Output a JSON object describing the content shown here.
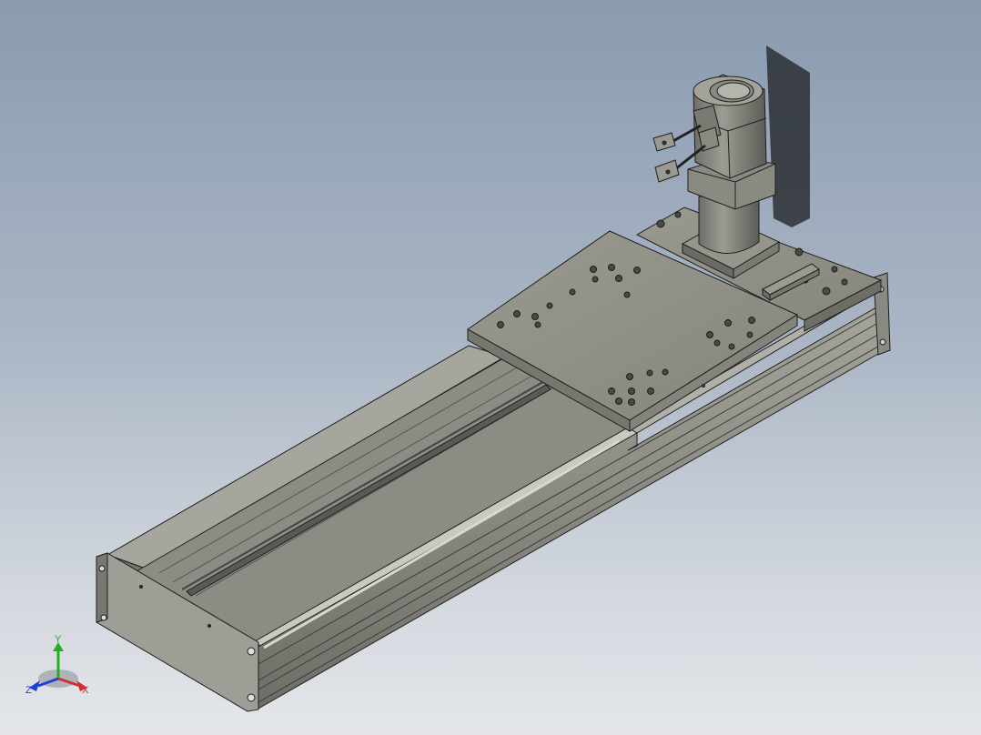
{
  "viewport": {
    "background_top": "#8a9bb0",
    "background_bottom": "#e4e6ea"
  },
  "model": {
    "part_color": "#8f8f86",
    "part_color_light": "#a3a39a",
    "part_color_dark": "#66665f",
    "edge_color": "#1e1e1e",
    "components": [
      "base-profile",
      "carriage-plate",
      "motor-flange-plate",
      "servo-motor",
      "motor-cables",
      "rails",
      "end-caps",
      "sensor-bracket"
    ]
  },
  "triad": {
    "x_label": "X",
    "y_label": "Y",
    "z_label": "Z",
    "x_color": "#d03030",
    "y_color": "#20b020",
    "z_color": "#2040d0"
  }
}
